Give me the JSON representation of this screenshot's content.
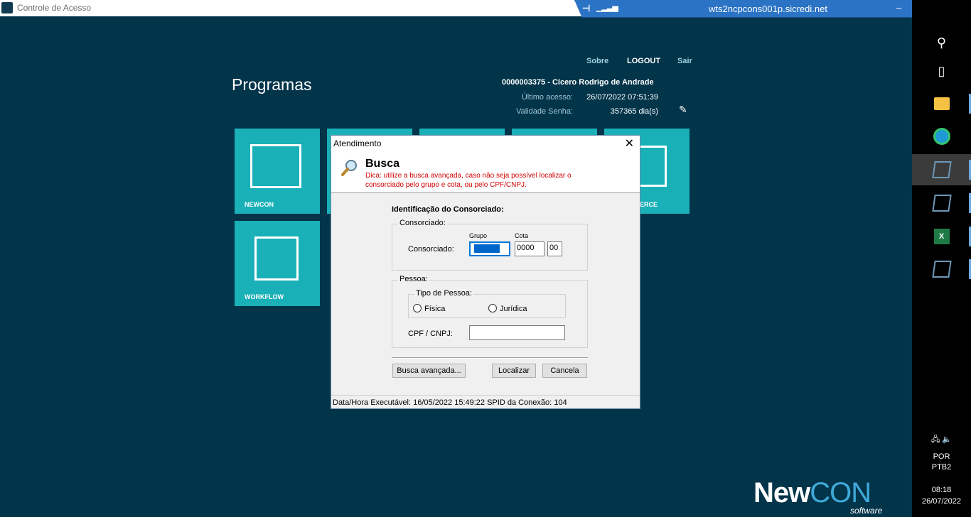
{
  "window": {
    "title": "Controle de Acesso",
    "min": "—",
    "max": "☐",
    "close": "✕"
  },
  "rdp": {
    "host": "wts2ncpcons001p.sicredi.net",
    "pin": "⊣",
    "signal": "▁▂▃▅",
    "min": "–",
    "restore": "❐",
    "close": "✕"
  },
  "nav": {
    "sobre": "Sobre",
    "logout": "LOGOUT",
    "sair": "Sair"
  },
  "page": {
    "title": "Programas"
  },
  "user": {
    "name": "0000003375 - Cícero Rodrigo de Andrade",
    "ultimo_acesso_label": "Último acesso:",
    "ultimo_acesso": "26/07/2022 07:51:39",
    "validade_label": "Validade Senha:",
    "validade": "357365 dia(s)",
    "edit_icon": "pencil-icon"
  },
  "tiles": [
    {
      "label": "NEWCON"
    },
    {
      "label": "WORKFLOW"
    },
    {
      "label": "ERCE"
    }
  ],
  "dialog": {
    "title": "Atendimento",
    "close": "✕",
    "heading": "Busca",
    "hint": "Dica: utilize a busca avançada, caso não seja possível localizar o consorciado pelo grupo e cota, ou pelo CPF/CNPJ.",
    "ident_title": "Identificação do Consorciado:",
    "consorciado_group": "Consorciado:",
    "grupo_label": "Grupo",
    "cota_label": "Cota",
    "consorciado_label": "Consorciado:",
    "grupo_value": "",
    "cota_value": "0000",
    "digito_value": "00",
    "pessoa_group": "Pessoa:",
    "tipo_pessoa_group": "Tipo de Pessoa:",
    "fisica": "Física",
    "juridica": "Jurídica",
    "cpf_label": "CPF / CNPJ:",
    "cpf_value": "",
    "btn_busca_avancada": "Busca avançada...",
    "btn_localizar": "Localizar",
    "btn_cancela": "Cancela",
    "status": "Data/Hora Executável: 16/05/2022  15:49:22 SPID da Conexão: 104"
  },
  "taskbar": {
    "lang1": "POR",
    "lang2": "PTB2",
    "time": "08:18",
    "date": "26/07/2022"
  },
  "brand": {
    "new": "New",
    "con": "CON",
    "sub": "software"
  }
}
